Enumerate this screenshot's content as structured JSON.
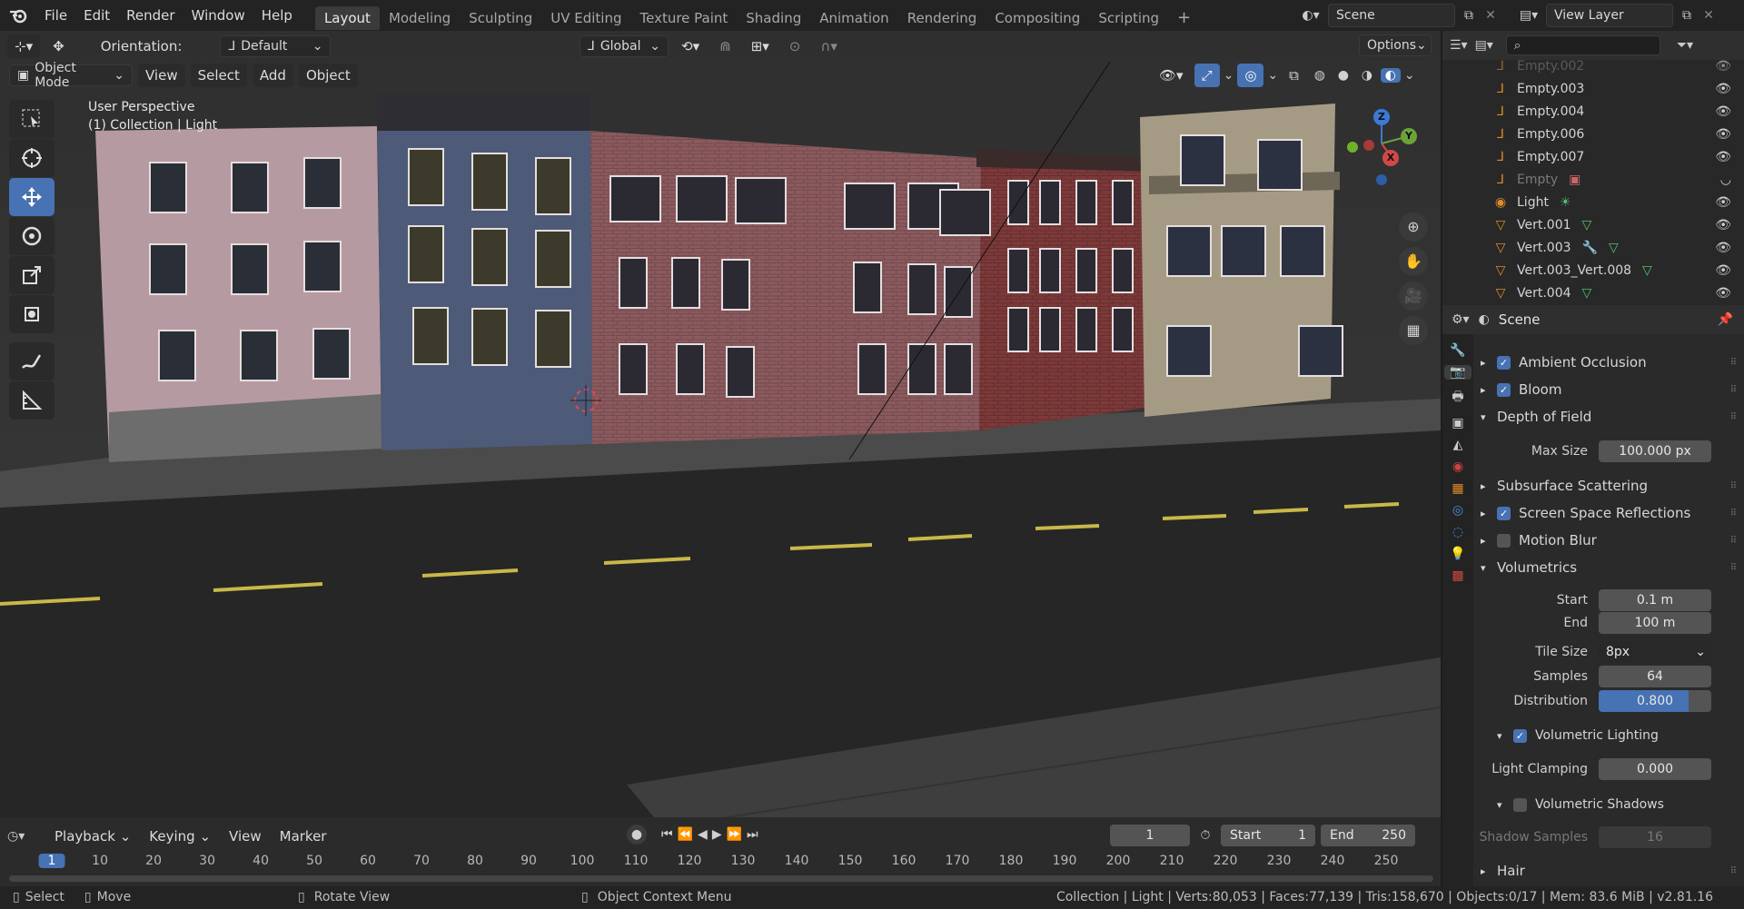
{
  "topbar": {
    "menus": [
      "File",
      "Edit",
      "Render",
      "Window",
      "Help"
    ],
    "workspaces": [
      "Layout",
      "Modeling",
      "Sculpting",
      "UV Editing",
      "Texture Paint",
      "Shading",
      "Animation",
      "Rendering",
      "Compositing",
      "Scripting"
    ],
    "active_workspace": "Layout",
    "scene": "Scene",
    "view_layer": "View Layer"
  },
  "viewport": {
    "orientation_label": "Orientation:",
    "orientation_value": "Default",
    "transform_space": "Global",
    "options": "Options",
    "mode": "Object Mode",
    "menus": [
      "View",
      "Select",
      "Add",
      "Object"
    ],
    "overlay_line1": "User Perspective",
    "overlay_line2": "(1) Collection | Light",
    "gizmo": {
      "z": "Z",
      "y": "Y",
      "x": "X"
    }
  },
  "outliner": {
    "items": [
      {
        "name": "Empty.002"
      },
      {
        "name": "Empty.003"
      },
      {
        "name": "Empty.004"
      },
      {
        "name": "Empty.006"
      },
      {
        "name": "Empty.007"
      },
      {
        "name": "Empty"
      },
      {
        "name": "Light"
      },
      {
        "name": "Vert.001"
      },
      {
        "name": "Vert.003"
      },
      {
        "name": "Vert.003_Vert.008"
      },
      {
        "name": "Vert.004"
      }
    ]
  },
  "properties": {
    "context": "Scene",
    "panels": {
      "ambient_occlusion": "Ambient Occlusion",
      "bloom": "Bloom",
      "depth_of_field": "Depth of Field",
      "max_size_label": "Max Size",
      "max_size_value": "100.000 px",
      "subsurface": "Subsurface Scattering",
      "ssr": "Screen Space Reflections",
      "motion_blur": "Motion Blur",
      "volumetrics": "Volumetrics",
      "start_label": "Start",
      "start_value": "0.1 m",
      "end_label": "End",
      "end_value": "100 m",
      "tile_label": "Tile Size",
      "tile_value": "8px",
      "samples_label": "Samples",
      "samples_value": "64",
      "distribution_label": "Distribution",
      "distribution_value": "0.800",
      "distribution_fraction": 0.8,
      "vol_lighting": "Volumetric Lighting",
      "light_clamping_label": "Light Clamping",
      "light_clamping_value": "0.000",
      "vol_shadows": "Volumetric Shadows",
      "shadow_samples_label": "Shadow Samples",
      "shadow_samples_value": "16",
      "hair": "Hair"
    }
  },
  "timeline": {
    "menus": [
      "Playback",
      "Keying",
      "View",
      "Marker"
    ],
    "current_frame": "1",
    "start_label": "Start",
    "start_value": "1",
    "end_label": "End",
    "end_value": "250",
    "ruler": [
      "1",
      "10",
      "20",
      "30",
      "40",
      "50",
      "60",
      "70",
      "80",
      "90",
      "100",
      "110",
      "120",
      "130",
      "140",
      "150",
      "160",
      "170",
      "180",
      "190",
      "200",
      "210",
      "220",
      "230",
      "240",
      "250"
    ]
  },
  "statusbar": {
    "select": "Select",
    "move": "Move",
    "rotate": "Rotate View",
    "context_menu": "Object Context Menu",
    "stats": "Collection | Light | Verts:80,053 | Faces:77,139 | Tris:158,670 | Objects:0/17 | Mem: 83.6 MiB | v2.81.16"
  },
  "colors": {
    "accent": "#4772b3",
    "bg": "#1d1d1d",
    "panel": "#2a2a2a"
  }
}
